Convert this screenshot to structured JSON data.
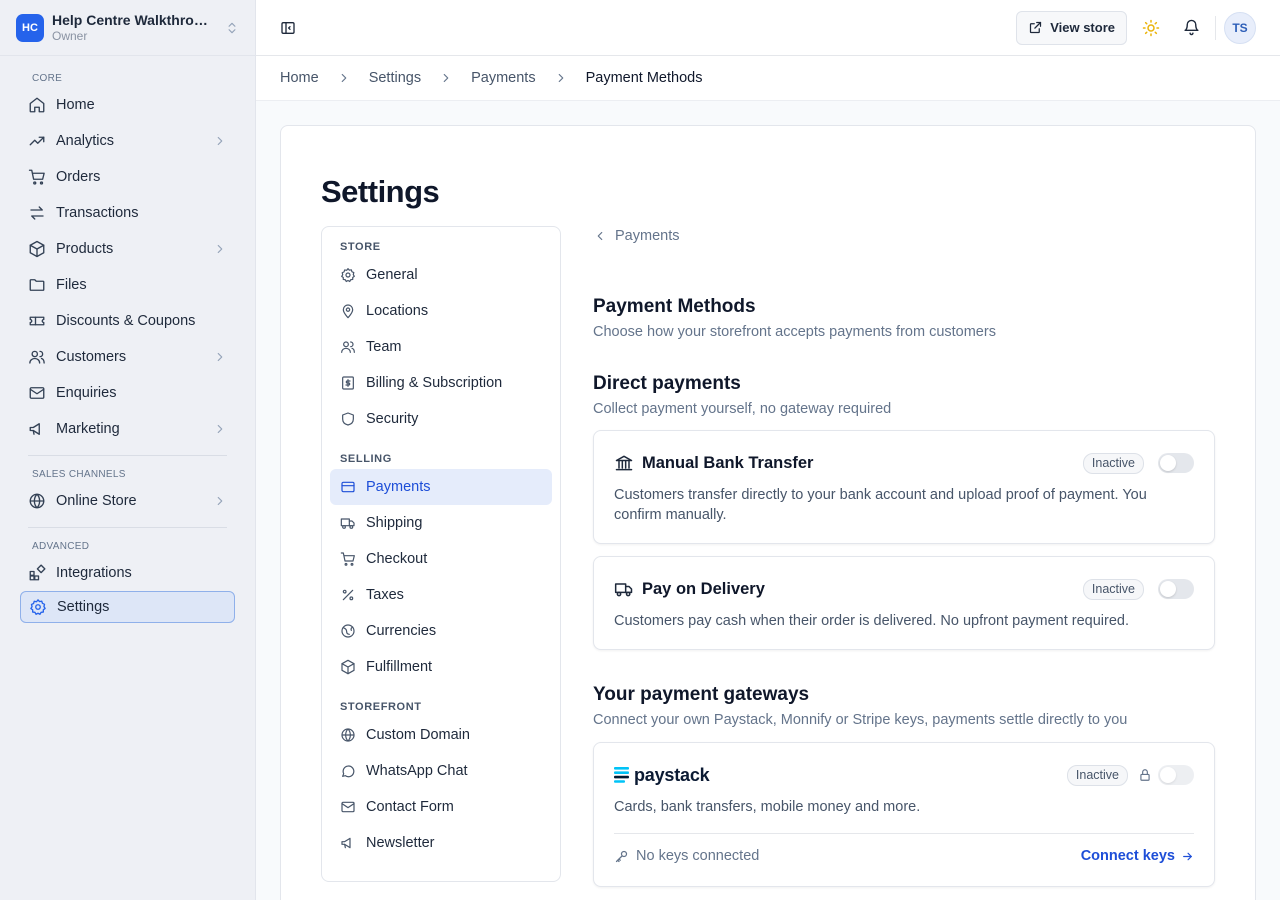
{
  "store": {
    "initials": "HC",
    "name": "Help Centre Walkthrough",
    "role": "Owner"
  },
  "sidebar": {
    "groups": {
      "core": "CORE",
      "sales_channels": "SALES CHANNELS",
      "advanced": "ADVANCED"
    },
    "items": {
      "home": "Home",
      "analytics": "Analytics",
      "orders": "Orders",
      "transactions": "Transactions",
      "products": "Products",
      "files": "Files",
      "discounts": "Discounts & Coupons",
      "customers": "Customers",
      "enquiries": "Enquiries",
      "marketing": "Marketing",
      "online_store": "Online Store",
      "integrations": "Integrations",
      "settings": "Settings"
    }
  },
  "topbar": {
    "view_store": "View store",
    "avatar_initials": "TS"
  },
  "breadcrumb": [
    "Home",
    "Settings",
    "Payments",
    "Payment Methods"
  ],
  "page_title": "Settings",
  "subnav": {
    "groups": {
      "store": "STORE",
      "selling": "SELLING",
      "storefront": "STOREFRONT"
    },
    "items": {
      "general": "General",
      "locations": "Locations",
      "team": "Team",
      "billing": "Billing & Subscription",
      "security": "Security",
      "payments": "Payments",
      "shipping": "Shipping",
      "checkout": "Checkout",
      "taxes": "Taxes",
      "currencies": "Currencies",
      "fulfillment": "Fulfillment",
      "custom_domain": "Custom Domain",
      "whatsapp": "WhatsApp Chat",
      "contact_form": "Contact Form",
      "newsletter": "Newsletter"
    }
  },
  "content": {
    "back_label": "Payments",
    "title": "Payment Methods",
    "subtitle": "Choose how your storefront accepts payments from customers",
    "direct": {
      "title": "Direct payments",
      "desc": "Collect payment yourself, no gateway required",
      "bank": {
        "name": "Manual Bank Transfer",
        "status": "Inactive",
        "desc": "Customers transfer directly to your bank account and upload proof of payment. You confirm manually."
      },
      "delivery": {
        "name": "Pay on Delivery",
        "status": "Inactive",
        "desc": "Customers pay cash when their order is delivered. No upfront payment required."
      }
    },
    "gateways": {
      "title": "Your payment gateways",
      "desc": "Connect your own Paystack, Monnify or Stripe keys, payments settle directly to you",
      "paystack": {
        "name": "paystack",
        "status": "Inactive",
        "desc": "Cards, bank transfers, mobile money and more.",
        "keys_status": "No keys connected",
        "connect_label": "Connect keys"
      }
    }
  },
  "colors": {
    "accent": "#1d4ed8",
    "brand": "#2563eb",
    "paystack": "#00c3f7"
  }
}
